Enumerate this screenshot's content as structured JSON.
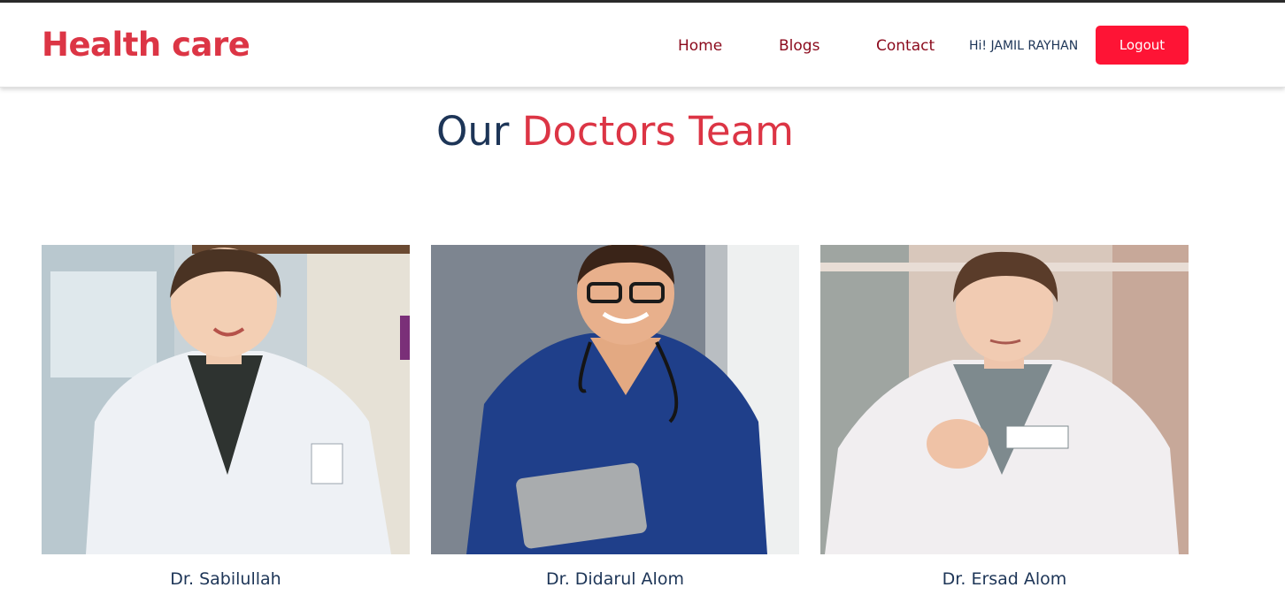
{
  "brand": {
    "name": "Health care",
    "color": "#dc3545"
  },
  "nav": {
    "items": [
      {
        "label": "Home"
      },
      {
        "label": "Blogs"
      },
      {
        "label": "Contact"
      }
    ],
    "greeting": "Hi! JAMIL RAYHAN",
    "logout_label": "Logout",
    "logout_color": "#fe1435"
  },
  "section": {
    "title_part1": "Our",
    "title_part2": "Doctors Team"
  },
  "doctors": [
    {
      "name": "Dr. Sabilullah"
    },
    {
      "name": "Dr. Didarul Alom"
    },
    {
      "name": "Dr. Ersad Alom"
    }
  ]
}
